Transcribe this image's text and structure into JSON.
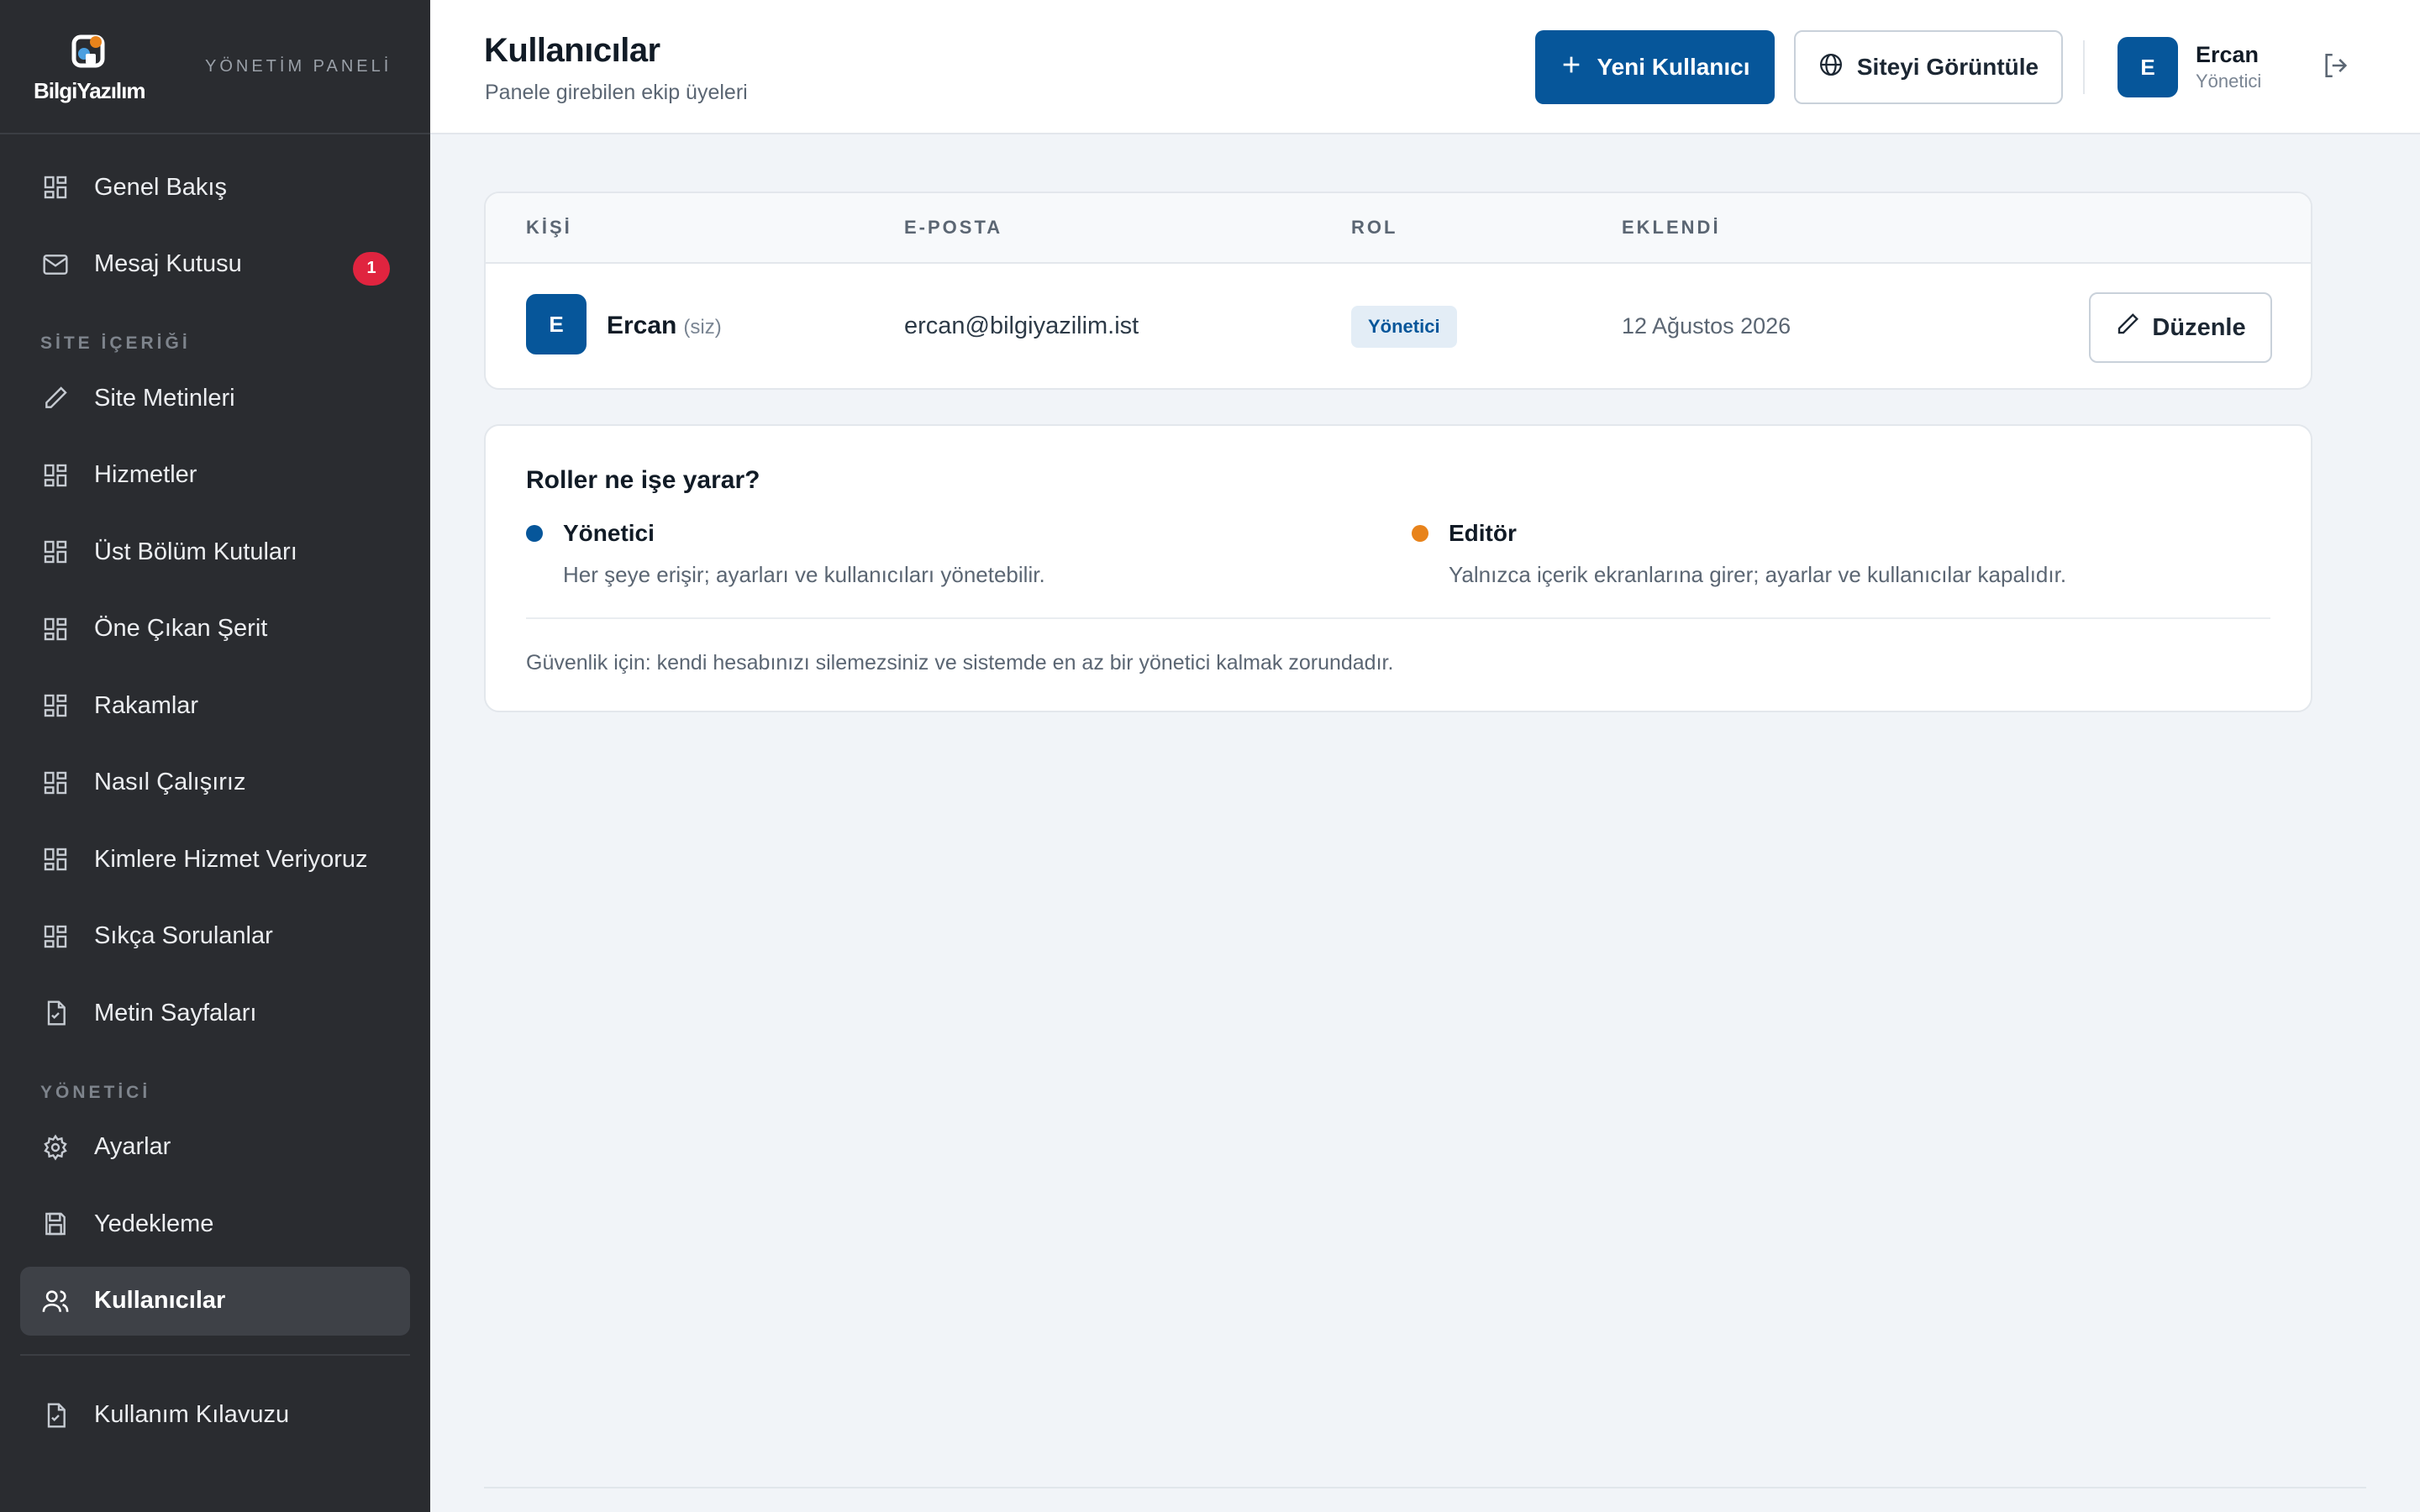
{
  "brand": {
    "logo_text": "BilgiYazılım",
    "panel_label": "YÖNETİM PANELİ"
  },
  "sidebar": {
    "items_main": [
      {
        "label": "Genel Bakış",
        "icon": "grid-icon"
      },
      {
        "label": "Mesaj Kutusu",
        "icon": "mail-icon",
        "badge": "1"
      }
    ],
    "section_content": "SİTE İÇERİĞİ",
    "items_content": [
      {
        "label": "Site Metinleri",
        "icon": "pencil-icon"
      },
      {
        "label": "Hizmetler",
        "icon": "grid-icon"
      },
      {
        "label": "Üst Bölüm Kutuları",
        "icon": "grid-icon"
      },
      {
        "label": "Öne Çıkan Şerit",
        "icon": "grid-icon"
      },
      {
        "label": "Rakamlar",
        "icon": "grid-icon"
      },
      {
        "label": "Nasıl Çalışırız",
        "icon": "grid-icon"
      },
      {
        "label": "Kimlere Hizmet Veriyoruz",
        "icon": "grid-icon"
      },
      {
        "label": "Sıkça Sorulanlar",
        "icon": "grid-icon"
      },
      {
        "label": "Metin Sayfaları",
        "icon": "document-icon"
      }
    ],
    "section_admin": "YÖNETİCİ",
    "items_admin": [
      {
        "label": "Ayarlar",
        "icon": "gear-icon"
      },
      {
        "label": "Yedekleme",
        "icon": "save-icon"
      },
      {
        "label": "Kullanıcılar",
        "icon": "users-icon",
        "active": true
      }
    ],
    "item_guide": {
      "label": "Kullanım Kılavuzu",
      "icon": "document-icon"
    }
  },
  "header": {
    "title": "Kullanıcılar",
    "subtitle": "Panele girebilen ekip üyeleri",
    "new_user_label": "Yeni Kullanıcı",
    "view_site_label": "Siteyi Görüntüle",
    "user_initial": "E",
    "user_name": "Ercan",
    "user_role": "Yönetici"
  },
  "table": {
    "columns": [
      "KİŞİ",
      "E-POSTA",
      "ROL",
      "EKLENDİ"
    ],
    "rows": [
      {
        "initial": "E",
        "name": "Ercan",
        "self_tag": "(siz)",
        "email": "ercan@bilgiyazilim.ist",
        "role": "Yönetici",
        "added": "12 Ağustos 2026",
        "edit_label": "Düzenle"
      }
    ]
  },
  "roles": {
    "title": "Roller ne işe yarar?",
    "items": [
      {
        "name": "Yönetici",
        "desc": "Her şeye erişir; ayarları ve kullanıcıları yönetebilir.",
        "color": "#06569a"
      },
      {
        "name": "Editör",
        "desc": "Yalnızca içerik ekranlarına girer; ayarlar ve kullanıcılar kapalıdır.",
        "color": "#e8831b"
      }
    ],
    "note": "Güvenlik için: kendi hesabınızı silemezsiniz ve sistemde en az bir yönetici kalmak zorundadır."
  },
  "colors": {
    "accent": "#06569a",
    "sidebar_bg": "#2a2c30",
    "badge": "#e0243f"
  }
}
